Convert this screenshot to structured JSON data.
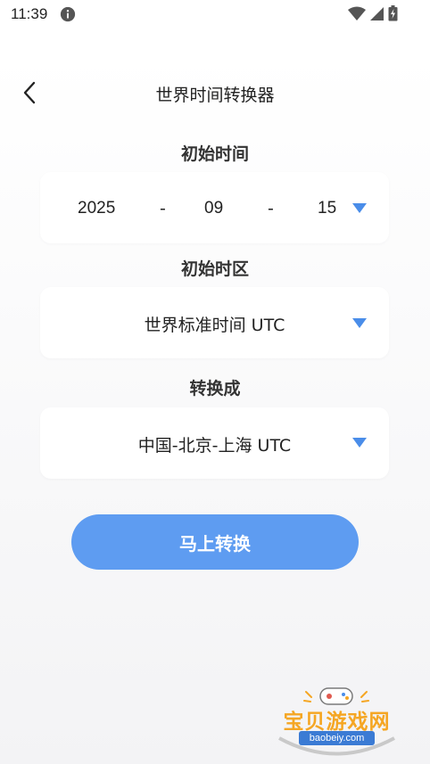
{
  "status_bar": {
    "time": "11:39"
  },
  "header": {
    "title": "世界时间转换器"
  },
  "start_time": {
    "label": "初始时间",
    "year": "2025",
    "separator": "-",
    "month": "09",
    "day": "15"
  },
  "start_zone": {
    "label": "初始时区",
    "value": "世界标准时间 UTC"
  },
  "target_zone": {
    "label": "转换成",
    "value": "中国-北京-上海 UTC"
  },
  "convert_button": {
    "label": "马上转换"
  },
  "watermark": {
    "name": "宝贝游戏网",
    "url": "baobeiy.com"
  },
  "colors": {
    "accent": "#5e9cf1",
    "arrow": "#4a8de9"
  }
}
